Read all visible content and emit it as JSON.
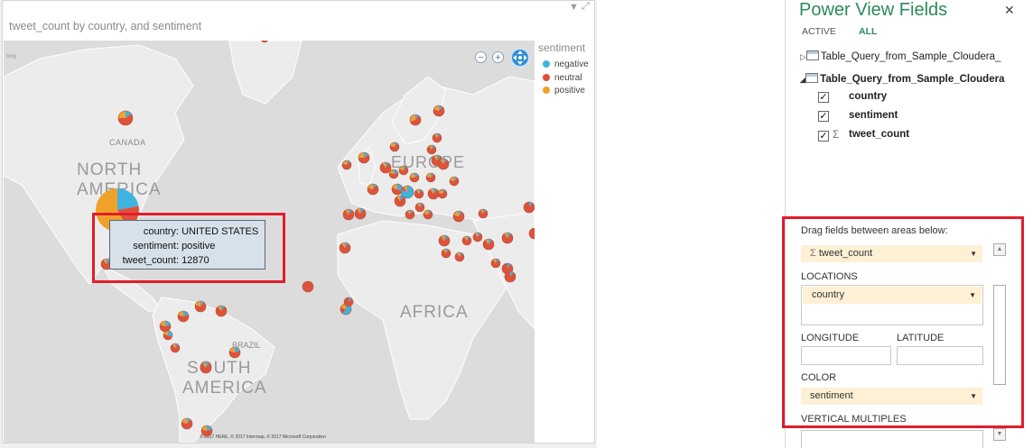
{
  "report": {
    "title": "tweet_count by country, and sentiment",
    "filter_icon": "filter-icon",
    "popout_icon": "popout-icon",
    "attribution": "© 2017 HERE, © 2017 Intermap, © 2017 Microsoft Corporation",
    "bing_logo": "bing"
  },
  "map_labels": {
    "canada": "CANADA",
    "north_america": [
      "NORTH",
      "AMERICA"
    ],
    "brazil": "BRAZIL",
    "south_america": [
      "SOUTH",
      "AMERICA"
    ],
    "europe": "EUROPE",
    "africa": "AFRICA"
  },
  "legend": {
    "title": "sentiment",
    "items": [
      {
        "label": "negative",
        "color": "#3fb3e0"
      },
      {
        "label": "neutral",
        "color": "#e0513a"
      },
      {
        "label": "positive",
        "color": "#f0a12a"
      }
    ]
  },
  "map_controls": {
    "zoom_out": "−",
    "zoom_in": "+"
  },
  "tooltip": {
    "rows": [
      {
        "key": "country:",
        "value": "UNITED STATES"
      },
      {
        "key": "sentiment:",
        "value": "positive"
      },
      {
        "key": "tweet_count:",
        "value": "12870"
      }
    ]
  },
  "fields_pane": {
    "title": "Power View Fields",
    "close": "✕",
    "tabs": {
      "active": "ACTIVE",
      "all": "ALL"
    },
    "tables": [
      {
        "name": "Table_Query_from_Sample_Cloudera_",
        "expanded": false,
        "arrow": "▷"
      },
      {
        "name": "Table_Query_from_Sample_Cloudera",
        "expanded": true,
        "arrow": "◢"
      }
    ],
    "fields": [
      {
        "name": "country",
        "checked": true,
        "sigma": false
      },
      {
        "name": "sentiment",
        "checked": true,
        "sigma": false
      },
      {
        "name": "tweet_count",
        "checked": true,
        "sigma": true
      }
    ]
  },
  "layout_section": {
    "header": "Drag fields between areas below:",
    "size_field": "tweet_count",
    "locations_label": "LOCATIONS",
    "locations_field": "country",
    "longitude_label": "LONGITUDE",
    "latitude_label": "LATITUDE",
    "color_label": "COLOR",
    "color_field": "sentiment",
    "vertical_multiples_label": "VERTICAL MULTIPLES",
    "sigma": "Σ",
    "dropdown_arrow": "▼"
  },
  "colors": {
    "accent_green": "#2b8a5a",
    "highlight_red": "#e11d2c"
  }
}
